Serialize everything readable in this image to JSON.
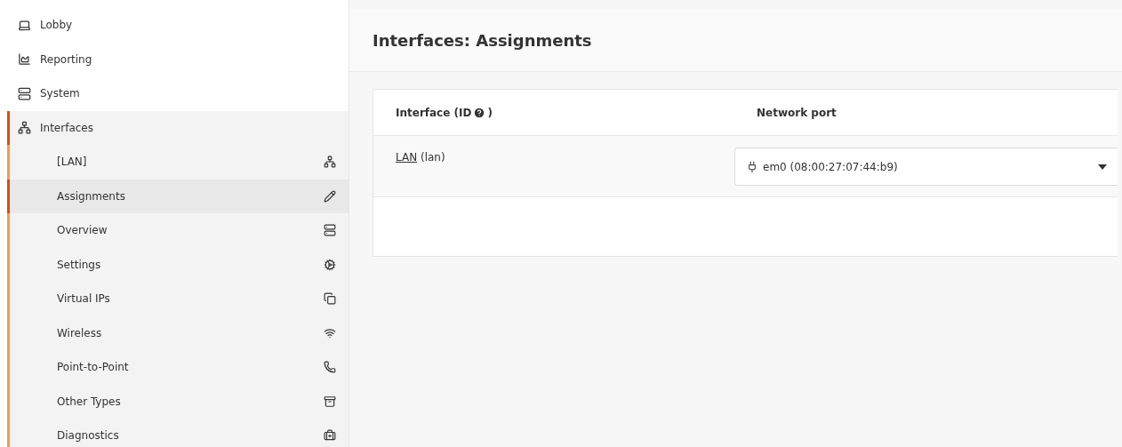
{
  "sidebar": {
    "items": [
      {
        "label": "Lobby",
        "selected": false
      },
      {
        "label": "Reporting",
        "selected": false
      },
      {
        "label": "System",
        "selected": false
      },
      {
        "label": "Interfaces",
        "selected": true,
        "children": [
          {
            "label": "[LAN]",
            "selected": false
          },
          {
            "label": "Assignments",
            "selected": true
          },
          {
            "label": "Overview",
            "selected": false
          },
          {
            "label": "Settings",
            "selected": false
          },
          {
            "label": "Virtual IPs",
            "selected": false
          },
          {
            "label": "Wireless",
            "selected": false
          },
          {
            "label": "Point-to-Point",
            "selected": false
          },
          {
            "label": "Other Types",
            "selected": false
          },
          {
            "label": "Diagnostics",
            "selected": false
          }
        ]
      }
    ]
  },
  "page": {
    "title": "Interfaces: Assignments"
  },
  "table": {
    "columns": [
      {
        "label": "Interface (ID",
        "suffix": ")"
      },
      {
        "label": "Network port"
      }
    ],
    "rows": [
      {
        "interface": "LAN",
        "id": "(lan)",
        "port": "em0 (08:00:27:07:44:b9)"
      }
    ]
  }
}
